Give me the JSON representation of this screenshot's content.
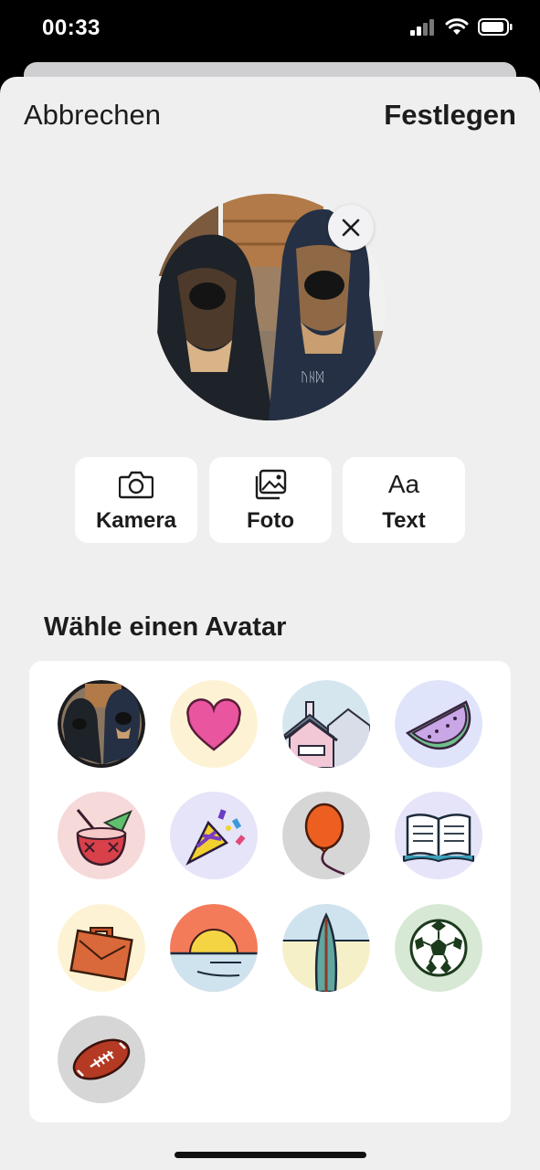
{
  "status_bar": {
    "time": "00:33"
  },
  "nav": {
    "cancel_label": "Abbrechen",
    "confirm_label": "Festlegen"
  },
  "preview": {
    "image": "dogs-in-hoodies-photo",
    "remove_icon": "close-icon"
  },
  "sources": [
    {
      "label": "Kamera",
      "icon": "camera-icon"
    },
    {
      "label": "Foto",
      "icon": "photo-icon"
    },
    {
      "label": "Text",
      "icon": "text-aa-icon",
      "glyph": "Aa"
    }
  ],
  "avatar_section": {
    "title": "Wähle einen Avatar",
    "avatars": [
      {
        "name": "photo",
        "bg": "#1c1c1e",
        "selected": true
      },
      {
        "name": "heart",
        "bg": "#fdf3d4"
      },
      {
        "name": "house",
        "bg": "#d5e6ef"
      },
      {
        "name": "watermelon",
        "bg": "#dfe4fa"
      },
      {
        "name": "cocktail",
        "bg": "#f6d9d9"
      },
      {
        "name": "party-popper",
        "bg": "#e5e4f8"
      },
      {
        "name": "balloon",
        "bg": "#d6d6d6"
      },
      {
        "name": "book",
        "bg": "#e5e4f8"
      },
      {
        "name": "briefcase",
        "bg": "#fdf3d4"
      },
      {
        "name": "sunset",
        "bg": "#f47b5a"
      },
      {
        "name": "surfboard",
        "bg": "#f6f0c8"
      },
      {
        "name": "soccer-ball",
        "bg": "#d7e8d5"
      },
      {
        "name": "football",
        "bg": "#d6d6d6"
      }
    ]
  }
}
